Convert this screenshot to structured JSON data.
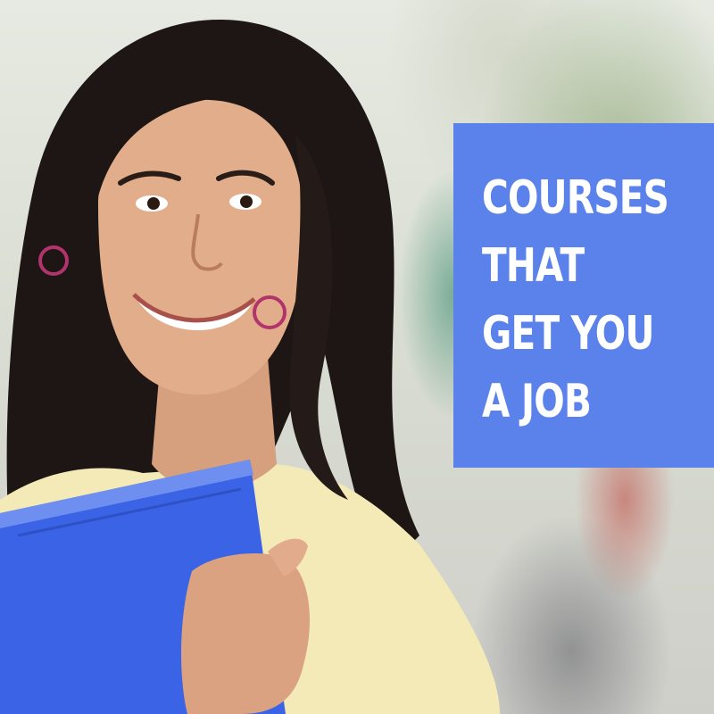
{
  "promo": {
    "headline_lines": [
      "COURSES",
      "THAT",
      "GET YOU",
      "A JOB"
    ],
    "box_color": "#5a82ea",
    "text_color": "#ffffff"
  },
  "photo": {
    "subject": "smiling student holding a blue folder",
    "folder_color": "#3a63e6"
  }
}
